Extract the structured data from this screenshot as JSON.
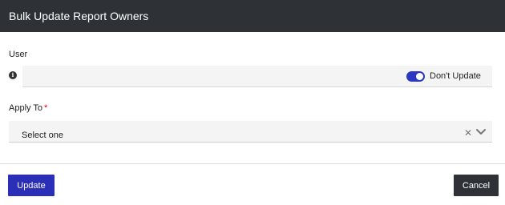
{
  "dialog": {
    "title": "Bulk Update Report Owners"
  },
  "user_field": {
    "label": "User",
    "info_icon": "info-icon",
    "value": "",
    "toggle": {
      "on": true,
      "label": "Don't Update"
    }
  },
  "apply_to_field": {
    "label": "Apply To",
    "required_marker": "*",
    "selected": "Select one",
    "clear_icon": "close-icon",
    "dropdown_icon": "chevron-down-icon"
  },
  "footer": {
    "update_label": "Update",
    "cancel_label": "Cancel"
  },
  "colors": {
    "titlebar": "#2e3237",
    "primary": "#2b2fb8",
    "toggle_on": "#2b39c1",
    "required": "#d0021b"
  }
}
